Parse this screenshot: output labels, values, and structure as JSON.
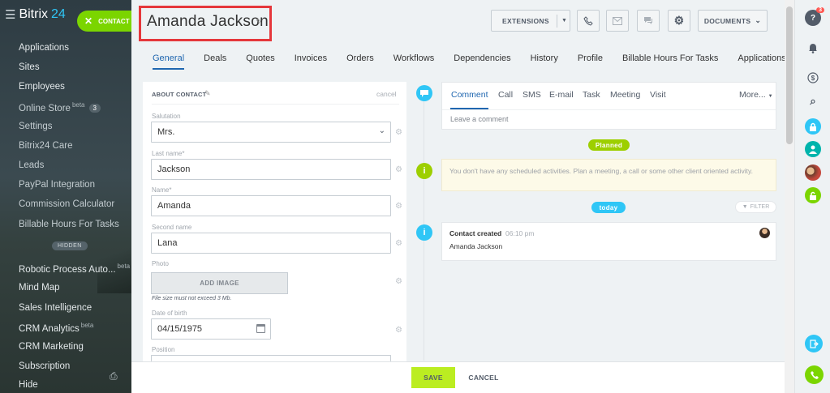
{
  "sidebar": {
    "brand": "Bitrix",
    "brand_num": "24",
    "items": [
      {
        "label": "Applications"
      },
      {
        "label": "Sites"
      },
      {
        "label": "Employees"
      },
      {
        "label": "Online Store",
        "badge": "beta",
        "count": "3"
      },
      {
        "label": "Settings"
      },
      {
        "label": "Bitrix24 Care"
      },
      {
        "label": "Leads"
      },
      {
        "label": "PayPal Integration"
      },
      {
        "label": "Commission Calculator"
      },
      {
        "label": "Billable Hours For Tasks"
      }
    ],
    "hidden_label": "HIDDEN",
    "hidden_items": [
      {
        "label": "Robotic Process Auto...",
        "badge": "beta"
      },
      {
        "label": "Mind Map"
      },
      {
        "label": "Sales Intelligence"
      },
      {
        "label": "CRM Analytics",
        "badge": "beta"
      },
      {
        "label": "CRM Marketing"
      },
      {
        "label": "Subscription"
      },
      {
        "label": "Hide"
      }
    ]
  },
  "contact_button": "CONTACT",
  "header": {
    "title": "Amanda  Jackson",
    "extensions": "EXTENSIONS",
    "documents": "DOCUMENTS"
  },
  "tabs": [
    "General",
    "Deals",
    "Quotes",
    "Invoices",
    "Orders",
    "Workflows",
    "Dependencies",
    "History",
    "Profile",
    "Billable Hours For Tasks",
    "Applications"
  ],
  "form": {
    "header": "ABOUT CONTACT",
    "cancel": "cancel",
    "salutation_label": "Salutation",
    "salutation_value": "Mrs.",
    "lastname_label": "Last name*",
    "lastname_value": "Jackson",
    "name_label": "Name*",
    "name_value": "Amanda",
    "secondname_label": "Second name",
    "secondname_value": "Lana",
    "photo_label": "Photo",
    "add_image": "ADD IMAGE",
    "photo_hint": "File size must not exceed 3 Mb.",
    "dob_label": "Date of birth",
    "dob_value": "04/15/1975",
    "position_label": "Position"
  },
  "activity": {
    "tabs": [
      "Comment",
      "Call",
      "SMS",
      "E-mail",
      "Task",
      "Meeting",
      "Visit"
    ],
    "more": "More...",
    "comment_placeholder": "Leave a comment",
    "planned": "Planned",
    "no_activities": "You don't have any scheduled activities. Plan a meeting, a call or some other client oriented activity.",
    "today": "today",
    "filter": "FILTER",
    "created_title": "Contact created",
    "created_time": "06:10 pm",
    "created_name": "Amanda Jackson"
  },
  "footer": {
    "save": "SAVE",
    "cancel": "CANCEL"
  },
  "right_panel": {
    "notifications": "3"
  },
  "colors": {
    "accent_green": "#bbed21",
    "link_blue": "#2067b0",
    "cyan": "#2fc6f6",
    "highlight_red": "#e5373b"
  }
}
